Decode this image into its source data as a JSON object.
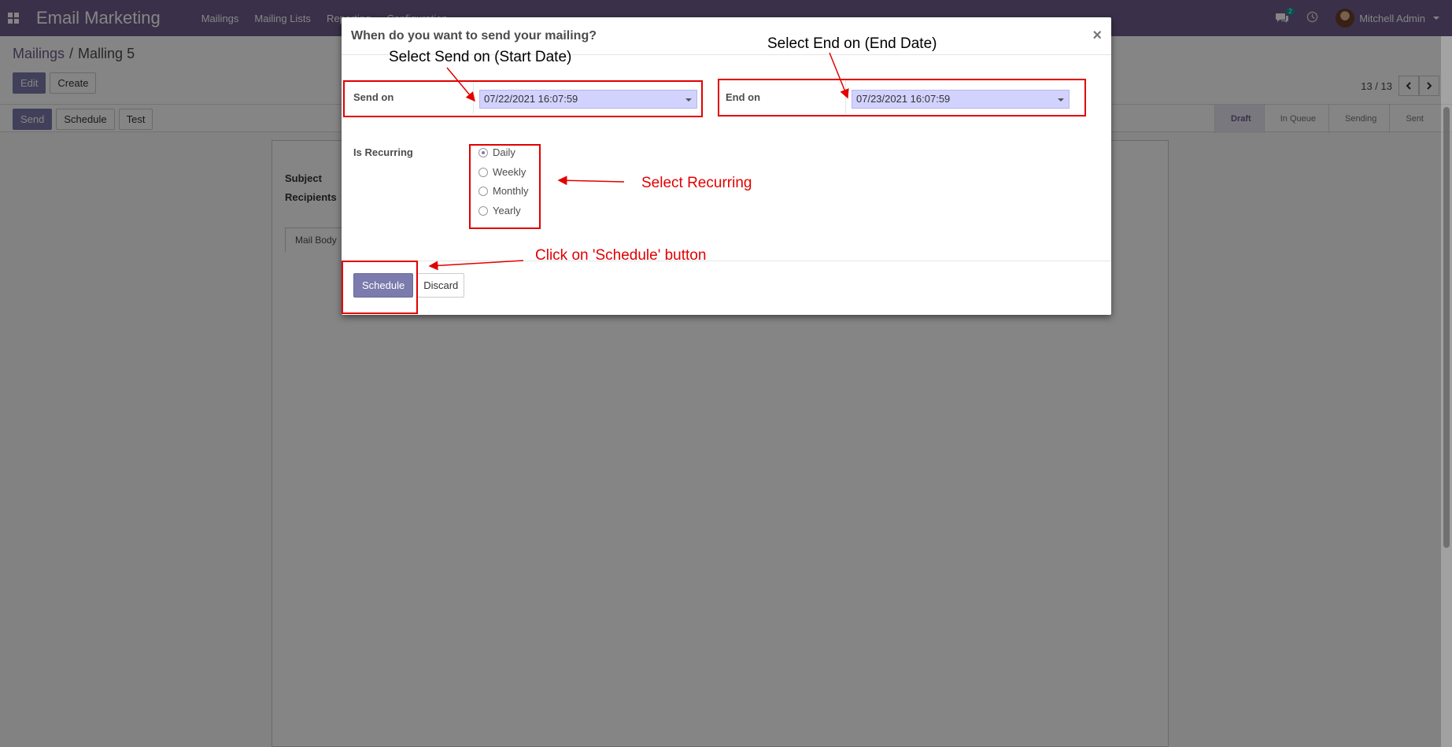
{
  "navbar": {
    "app_title": "Email Marketing",
    "menu": [
      "Mailings",
      "Mailing Lists",
      "Reporting",
      "Configuration"
    ],
    "chat_badge": "2",
    "user_name": "Mitchell Admin"
  },
  "breadcrumb": {
    "parent": "Mailings",
    "separator": "/",
    "current": "Malling 5"
  },
  "control_panel": {
    "edit_label": "Edit",
    "create_label": "Create",
    "pager": "13 / 13"
  },
  "statusbar": {
    "buttons": [
      "Send",
      "Schedule",
      "Test"
    ],
    "stages": [
      "Draft",
      "In Queue",
      "Sending",
      "Sent"
    ],
    "active_stage": "Draft"
  },
  "sheet": {
    "subject_label": "Subject",
    "recipients_label": "Recipients",
    "tab_label": "Mail Body"
  },
  "modal": {
    "title": "When do you want to send your mailing?",
    "close_symbol": "×",
    "send_on_label": "Send on",
    "send_on_value": "07/22/2021 16:07:59",
    "end_on_label": "End on",
    "end_on_value": "07/23/2021 16:07:59",
    "recurring_label": "Is Recurring",
    "recurring_options": [
      "Daily",
      "Weekly",
      "Monthly",
      "Yearly"
    ],
    "recurring_selected": "Daily",
    "schedule_label": "Schedule",
    "discard_label": "Discard"
  },
  "annotations": {
    "start_date": "Select Send on (Start Date)",
    "end_date": "Select End on (End Date)",
    "recurring": "Select Recurring",
    "schedule": "Click on 'Schedule' button"
  },
  "colors": {
    "navbar": "#6f5d8d",
    "primary": "#7c7bad",
    "annotation_red": "#e20000",
    "date_field": "#d2d2ff"
  }
}
